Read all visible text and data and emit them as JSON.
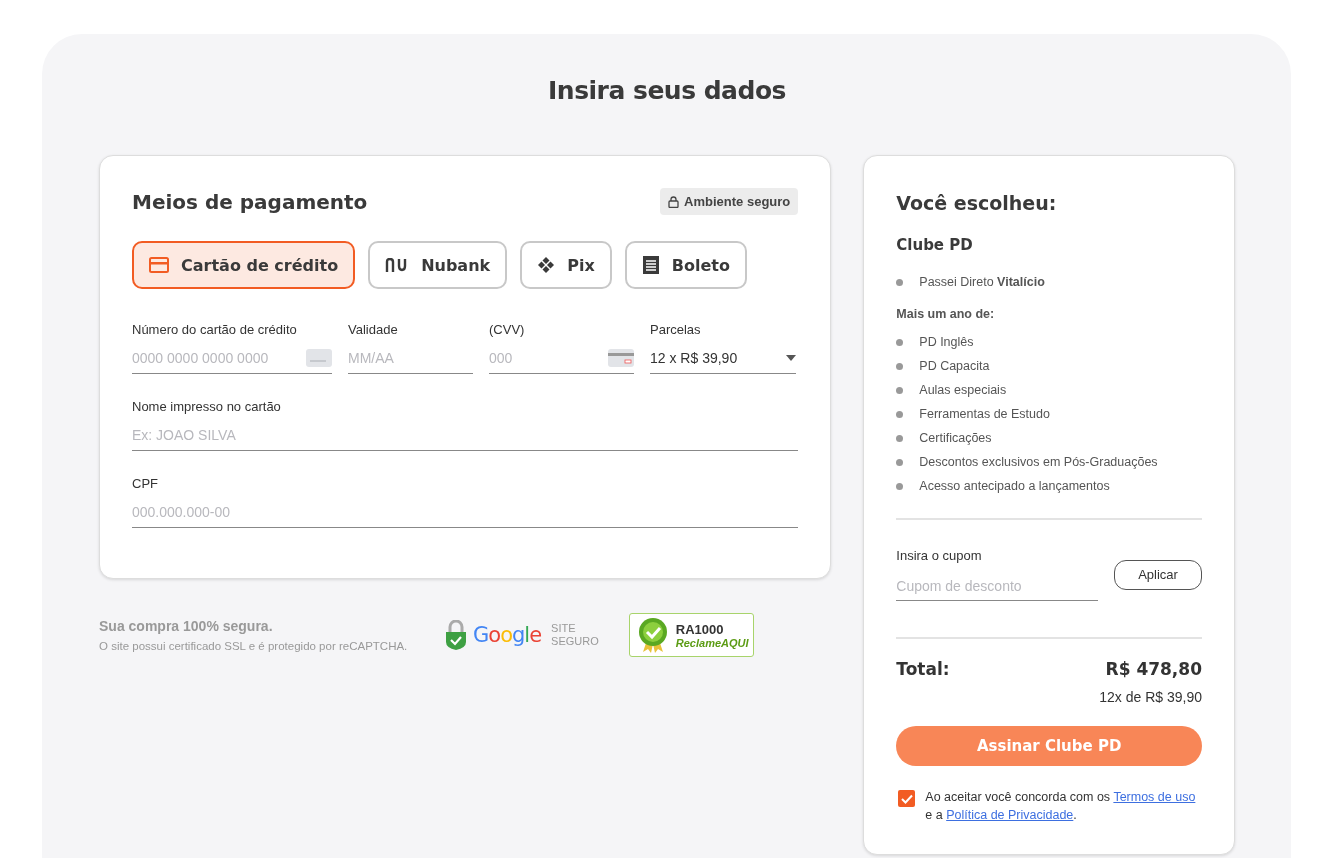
{
  "page_title": "Insira seus dados",
  "payment": {
    "title": "Meios de pagamento",
    "secure_badge": "Ambiente seguro",
    "methods": [
      {
        "kind": "card",
        "label": "Cartão de crédito",
        "selected": true
      },
      {
        "kind": "nubank",
        "label": "Nubank",
        "selected": false
      },
      {
        "kind": "pix",
        "label": "Pix",
        "selected": false
      },
      {
        "kind": "boleto",
        "label": "Boleto",
        "selected": false
      }
    ],
    "fields_row": [
      {
        "kind": "card_number",
        "label": "Número do cartão de crédito",
        "placeholder": "0000 0000 0000 0000"
      },
      {
        "kind": "expiry",
        "label": "Validade",
        "placeholder": "MM/AA"
      },
      {
        "kind": "cvv",
        "label": "(CVV)",
        "placeholder": "000"
      },
      {
        "kind": "select",
        "label": "Parcelas",
        "value": "12 x R$ 39,90"
      }
    ],
    "fields": [
      {
        "label": "Nome impresso no cartão",
        "placeholder": "Ex: JOAO SILVA"
      },
      {
        "label": "CPF",
        "placeholder": "000.000.000-00"
      }
    ]
  },
  "security": {
    "title": "Sua compra 100% segura.",
    "subtitle": "O site possui certificado SSL e é protegido por reCAPTCHA.",
    "google_badge": {
      "logo": "Google",
      "caption_1": "SITE",
      "caption_2": "SEGURO"
    },
    "ra_badge": {
      "line_1": "RA1000",
      "line_2": "ReclameAQUI"
    }
  },
  "summary": {
    "title": "Você escolheu:",
    "product": "Clube PD",
    "items": [
      {
        "kind": "bullet",
        "text": "Passei Direto **Vitalício**"
      },
      {
        "kind": "heading",
        "text": "**Mais um ano de:**"
      },
      {
        "kind": "bullet",
        "text": "PD Inglês"
      },
      {
        "kind": "bullet",
        "text": "PD Capacita"
      },
      {
        "kind": "bullet",
        "text": "Aulas especiais"
      },
      {
        "kind": "bullet",
        "text": "Ferramentas de Estudo"
      },
      {
        "kind": "bullet",
        "text": "Certificações"
      },
      {
        "kind": "bullet",
        "text": "Descontos exclusivos em Pós-Graduações"
      },
      {
        "kind": "bullet",
        "text": "Acesso antecipado a lançamentos"
      }
    ],
    "coupon": {
      "label": "Insira o cupom",
      "placeholder": "Cupom de desconto",
      "button": "Aplicar"
    },
    "total_label": "Total:",
    "total_value": "R$ 478,80",
    "installments": "12x de R$ 39,90",
    "submit": "Assinar Clube PD",
    "terms": {
      "checked": true,
      "before": "Ao aceitar você concorda com os",
      "link_1": "Termos de uso",
      "middle": "e a",
      "link_2": "Política de Privacidade",
      "after": "."
    }
  }
}
